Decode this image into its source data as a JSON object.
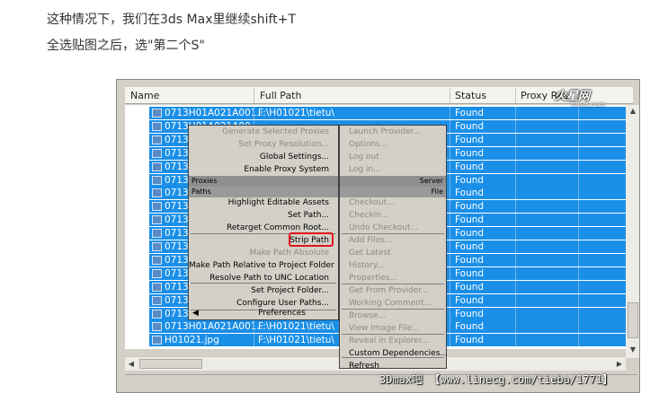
{
  "article": {
    "line1": "这种情况下，我们在3ds Max里继续shift+T",
    "line2": "全选贴图之后，选\"第二个S\""
  },
  "table": {
    "columns": [
      "Name",
      "Full Path",
      "Status",
      "Proxy Res..."
    ],
    "rows": [
      {
        "name": "0713H01A021A001...",
        "path": "F:\\H01021\\tietu\\",
        "status": "Found"
      },
      {
        "name": "0713H01A021A00",
        "path": "",
        "status": "Found"
      },
      {
        "name": "0713H01A02",
        "path": "",
        "status": "Found"
      },
      {
        "name": "0713H01A02",
        "path": "",
        "status": "Found"
      },
      {
        "name": "0713H01A02",
        "path": "",
        "status": "Found"
      },
      {
        "name": "0713H01A02",
        "path": "",
        "status": "Found"
      },
      {
        "name": "0713I",
        "path": "",
        "status": "Found"
      },
      {
        "name": "0713I",
        "path": "",
        "status": "Found"
      },
      {
        "name": "0713I",
        "path": "",
        "status": "Found"
      },
      {
        "name": "0713I",
        "path": "",
        "status": "Found"
      },
      {
        "name": "0713I",
        "path": "",
        "status": "Found"
      },
      {
        "name": "0713I",
        "path": "",
        "status": "Found"
      },
      {
        "name": "0713I",
        "path": "",
        "status": "Found"
      },
      {
        "name": "0713I",
        "path": "",
        "status": "Found"
      },
      {
        "name": "0713I",
        "path": "",
        "status": "Found"
      },
      {
        "name": "0713I",
        "path": "",
        "status": "Found"
      },
      {
        "name": "0713H01A021A001...",
        "path": "F:\\H01021\\tietu\\",
        "status": "Found"
      },
      {
        "name": "H01021.jpg",
        "path": "F:\\H01021\\tietu\\",
        "status": "Found"
      }
    ]
  },
  "menu_left": {
    "top_items": [
      {
        "label": "Generate Selected Proxies",
        "disabled": true
      },
      {
        "label": "Set Proxy Resolution...",
        "disabled": true
      },
      {
        "label": "Global Settings...",
        "disabled": false
      },
      {
        "label": "Enable Proxy System",
        "disabled": false
      }
    ],
    "proxies_header": "Proxies",
    "paths_header": "Paths",
    "path_items": [
      {
        "label": "Highlight Editable Assets",
        "disabled": false
      },
      {
        "label": "Set Path...",
        "disabled": false
      },
      {
        "label": "Retarget Common Root...",
        "disabled": false
      },
      {
        "label": "Strip Path",
        "disabled": false
      },
      {
        "label": "Make Path Absolute",
        "disabled": true
      },
      {
        "label": "Make Path Relative to Project Folder",
        "disabled": false
      },
      {
        "label": "Resolve Path to UNC Location",
        "disabled": false
      },
      {
        "label": "Set Project Folder...",
        "disabled": false
      },
      {
        "label": "Configure User Paths...",
        "disabled": false
      }
    ],
    "preferences": "Preferences"
  },
  "menu_right": {
    "top_items": [
      "Launch Provider...",
      "Options...",
      "Log out",
      "Log in..."
    ],
    "server_header": "Server",
    "file_header": "File",
    "file_items": [
      {
        "label": "Checkout...",
        "disabled": true
      },
      {
        "label": "Checkin...",
        "disabled": true
      },
      {
        "label": "Undo Checkout...",
        "disabled": true
      },
      {
        "label": "Add Files...",
        "disabled": true
      },
      {
        "label": "Get Latest",
        "disabled": true
      },
      {
        "label": "History...",
        "disabled": true
      },
      {
        "label": "Properties...",
        "disabled": true
      },
      {
        "label": "Get From Provider...",
        "disabled": true
      },
      {
        "label": "Working Comment...",
        "disabled": true
      },
      {
        "label": "Browse...",
        "disabled": true
      },
      {
        "label": "View Image File...",
        "disabled": true
      },
      {
        "label": "Reveal in Explorer...",
        "disabled": true
      },
      {
        "label": "Custom Dependencies...",
        "disabled": false
      },
      {
        "label": "Refresh",
        "disabled": false
      }
    ]
  },
  "watermark": {
    "site_logo": "火星网",
    "site_logo_sub": "hxsd.com",
    "bottom": "3Dmax吧 【www.linecg.com/tieba/1771】"
  },
  "colors": {
    "selection": "#1a8fe8",
    "menu_bg": "#d4d0c8",
    "highlight_box": "#e0141e"
  }
}
